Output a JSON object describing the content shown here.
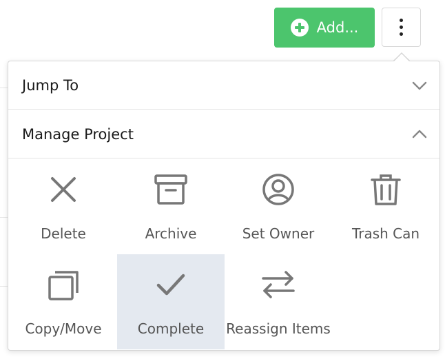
{
  "toolbar": {
    "add_label": "Add...",
    "add_icon": "plus-circle-icon",
    "more_icon": "vertical-ellipsis-icon"
  },
  "colors": {
    "accent_green": "#4cc56d",
    "selected_bg": "#e4e9f0",
    "icon_gray": "#777777"
  },
  "menu": {
    "jump_to": {
      "label": "Jump To",
      "expanded": false
    },
    "manage_project": {
      "label": "Manage Project",
      "expanded": true
    },
    "actions": [
      {
        "label": "Delete",
        "icon": "x-icon"
      },
      {
        "label": "Archive",
        "icon": "archive-box-icon"
      },
      {
        "label": "Set Owner",
        "icon": "user-circle-icon"
      },
      {
        "label": "Trash Can",
        "icon": "trash-can-icon"
      },
      {
        "label": "Copy/Move",
        "icon": "copy-icon"
      },
      {
        "label": "Complete",
        "icon": "checkmark-icon",
        "selected": true
      },
      {
        "label": "Reassign Items",
        "icon": "swap-arrows-icon"
      }
    ]
  }
}
